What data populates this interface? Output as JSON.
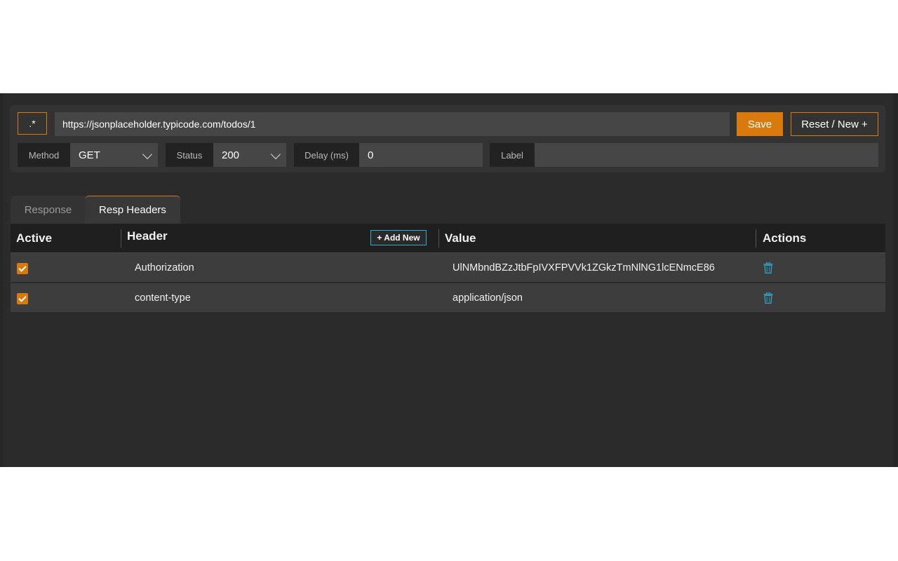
{
  "config": {
    "regex_label": ".*",
    "url_value": "https://jsonplaceholder.typicode.com/todos/1",
    "save_label": "Save",
    "reset_label": "Reset / New +",
    "method_label": "Method",
    "method_value": "GET",
    "status_label": "Status",
    "status_value": "200",
    "delay_label": "Delay (ms)",
    "delay_value": "0",
    "label_label": "Label",
    "label_value": ""
  },
  "tabs": [
    {
      "label": "Response",
      "active": false
    },
    {
      "label": "Resp Headers",
      "active": true
    }
  ],
  "table": {
    "columns": {
      "active": "Active",
      "header": "Header",
      "value": "Value",
      "actions": "Actions"
    },
    "add_new_label": "+ Add New",
    "rows": [
      {
        "active": true,
        "header": "Authorization",
        "value": "UlNMbndBZzJtbFpIVXFPVVk1ZGkzTmNlNG1lcENmcE86"
      },
      {
        "active": true,
        "header": "content-type",
        "value": "application/json"
      }
    ]
  },
  "colors": {
    "accent": "#d97a0f",
    "link_accent": "#3aa9c7"
  },
  "icons": {
    "delete": "trash-icon",
    "checkbox": "checkbox-checked-icon",
    "dropdown": "chevron-down-icon"
  }
}
